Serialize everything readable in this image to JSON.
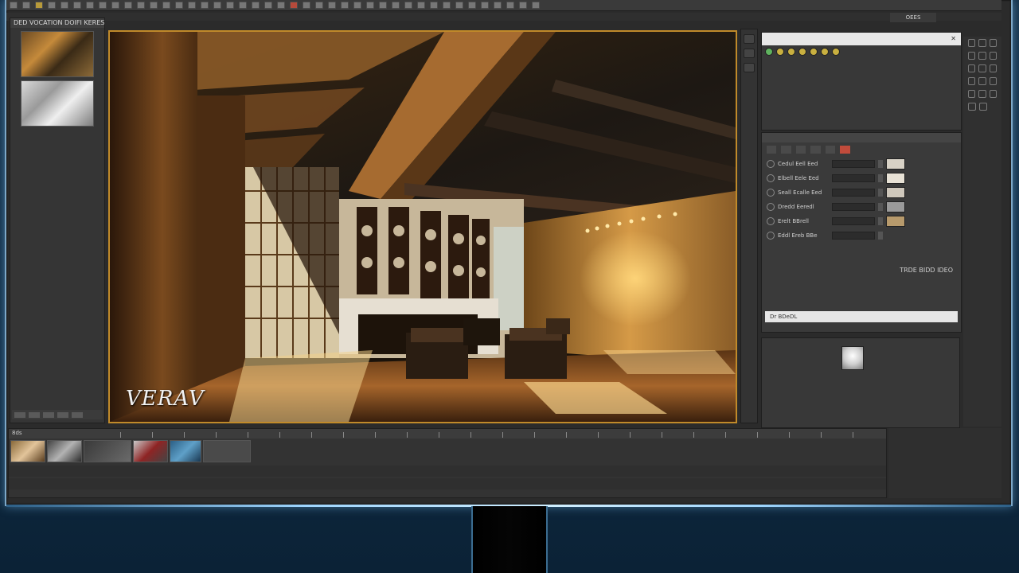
{
  "app": {
    "left_panel_title": "DED VOCATION DOIFI KERES",
    "viewport_logo": "VERAV",
    "material_panel_footer": "TRDE BIDD IDEO",
    "material_bar_label": "Dr BDeDL",
    "timeline_label": "8ds",
    "far_right_tab": "OEES"
  },
  "material_params": [
    {
      "label": "Cedul Eell Eed",
      "swatch": "#d8d2c6"
    },
    {
      "label": "Elbell Eele Eed",
      "swatch": "#e8e2d6"
    },
    {
      "label": "Seall Ecalle Eed",
      "swatch": "#cfc8bc"
    },
    {
      "label": "Dredd Eeredl",
      "swatch": "#9a9a9a"
    },
    {
      "label": "Erelt BBrell",
      "swatch": "#b79a6c"
    },
    {
      "label": "Eddl Ereb BBe",
      "swatch": ""
    }
  ],
  "colors": {
    "accent": "#c08a2a",
    "monitor_border": "#7da8c8"
  }
}
